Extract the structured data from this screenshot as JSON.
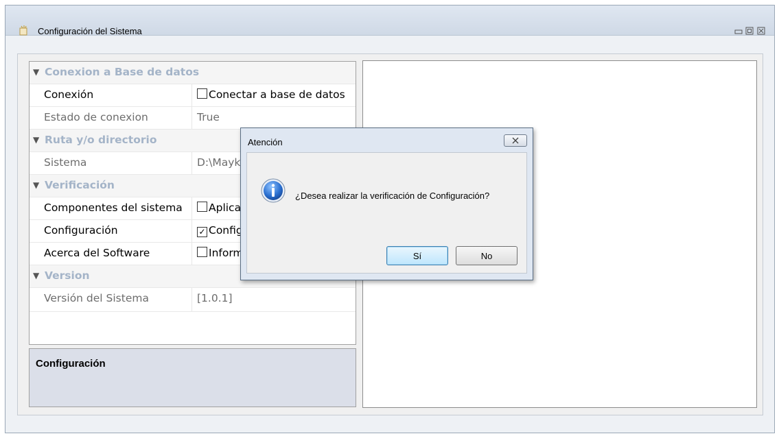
{
  "window": {
    "title": "Configuración del Sistema",
    "icons": [
      "app-icon",
      "minimize-icon",
      "maximize-icon",
      "close-icon"
    ]
  },
  "property_grid": {
    "categories": [
      {
        "name": "Conexion a Base de datos",
        "rows": [
          {
            "name": "Conexión",
            "value": "Conectar a base de datos",
            "checkbox": "unchecked",
            "style": "dark"
          },
          {
            "name": "Estado de conexion",
            "value": "True",
            "checkbox": null,
            "style": "gray"
          }
        ]
      },
      {
        "name": "Ruta y/o directorio",
        "rows": [
          {
            "name": "Sistema",
            "value": "D:\\Mayk",
            "checkbox": null,
            "style": "gray"
          }
        ]
      },
      {
        "name": "Verificación",
        "rows": [
          {
            "name": "Componentes del sistema",
            "value": "Aplica",
            "checkbox": "unchecked",
            "style": "dark"
          },
          {
            "name": "Configuración",
            "value": "Config",
            "checkbox": "checked",
            "style": "dark"
          },
          {
            "name": "Acerca del Software",
            "value": "Inform",
            "checkbox": "unchecked",
            "style": "dark"
          }
        ]
      },
      {
        "name": "Version",
        "rows": [
          {
            "name": "Versión del Sistema",
            "value": "[1.0.1]",
            "checkbox": null,
            "style": "gray"
          }
        ]
      }
    ]
  },
  "description": {
    "title": "Configuración"
  },
  "dialog": {
    "title": "Atención",
    "message": "¿Desea realizar la verificación de Configuración?",
    "yes_label": "Sí",
    "no_label": "No",
    "icon": "info-icon",
    "colors": {
      "title_bg": "#dfe7f2",
      "default_button": "#bee6fd"
    }
  },
  "colors": {
    "category_text": "#a4b4c8",
    "window_bg": "#eef1f5",
    "description_bg": "#dbdfe9"
  }
}
